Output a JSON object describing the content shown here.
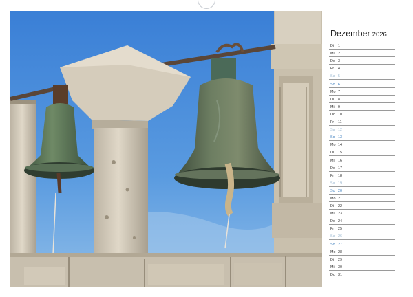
{
  "calendar": {
    "month": "Dezember",
    "year": "2026",
    "days": [
      {
        "d": "Di",
        "n": "1",
        "t": "w"
      },
      {
        "d": "Mi",
        "n": "2",
        "t": "w"
      },
      {
        "d": "Do",
        "n": "3",
        "t": "w"
      },
      {
        "d": "Fr",
        "n": "4",
        "t": "w"
      },
      {
        "d": "Sa",
        "n": "5",
        "t": "sat"
      },
      {
        "d": "So",
        "n": "6",
        "t": "sun"
      },
      {
        "d": "Mo",
        "n": "7",
        "t": "w"
      },
      {
        "d": "Di",
        "n": "8",
        "t": "w"
      },
      {
        "d": "Mi",
        "n": "9",
        "t": "w"
      },
      {
        "d": "Do",
        "n": "10",
        "t": "w"
      },
      {
        "d": "Fr",
        "n": "11",
        "t": "w"
      },
      {
        "d": "Sa",
        "n": "12",
        "t": "sat"
      },
      {
        "d": "So",
        "n": "13",
        "t": "sun"
      },
      {
        "d": "Mo",
        "n": "14",
        "t": "w"
      },
      {
        "d": "Di",
        "n": "15",
        "t": "w"
      },
      {
        "d": "Mi",
        "n": "16",
        "t": "w"
      },
      {
        "d": "Do",
        "n": "17",
        "t": "w"
      },
      {
        "d": "Fr",
        "n": "18",
        "t": "w"
      },
      {
        "d": "Sa",
        "n": "19",
        "t": "sat"
      },
      {
        "d": "So",
        "n": "20",
        "t": "sun"
      },
      {
        "d": "Mo",
        "n": "21",
        "t": "w"
      },
      {
        "d": "Di",
        "n": "22",
        "t": "w"
      },
      {
        "d": "Mi",
        "n": "23",
        "t": "w"
      },
      {
        "d": "Do",
        "n": "24",
        "t": "w"
      },
      {
        "d": "Fr",
        "n": "25",
        "t": "w"
      },
      {
        "d": "Sa",
        "n": "26",
        "t": "sat"
      },
      {
        "d": "So",
        "n": "27",
        "t": "sun"
      },
      {
        "d": "Mo",
        "n": "28",
        "t": "w"
      },
      {
        "d": "Di",
        "n": "29",
        "t": "w"
      },
      {
        "d": "Mi",
        "n": "30",
        "t": "w"
      },
      {
        "d": "Do",
        "n": "31",
        "t": "w"
      }
    ]
  },
  "colors": {
    "weekday": "#333333",
    "saturday": "#9ab7d0",
    "sunday": "#3c7dbe",
    "sky": "#3f86d8"
  },
  "photo": {
    "subject": "bronze-bells-in-stone-bell-tower"
  }
}
